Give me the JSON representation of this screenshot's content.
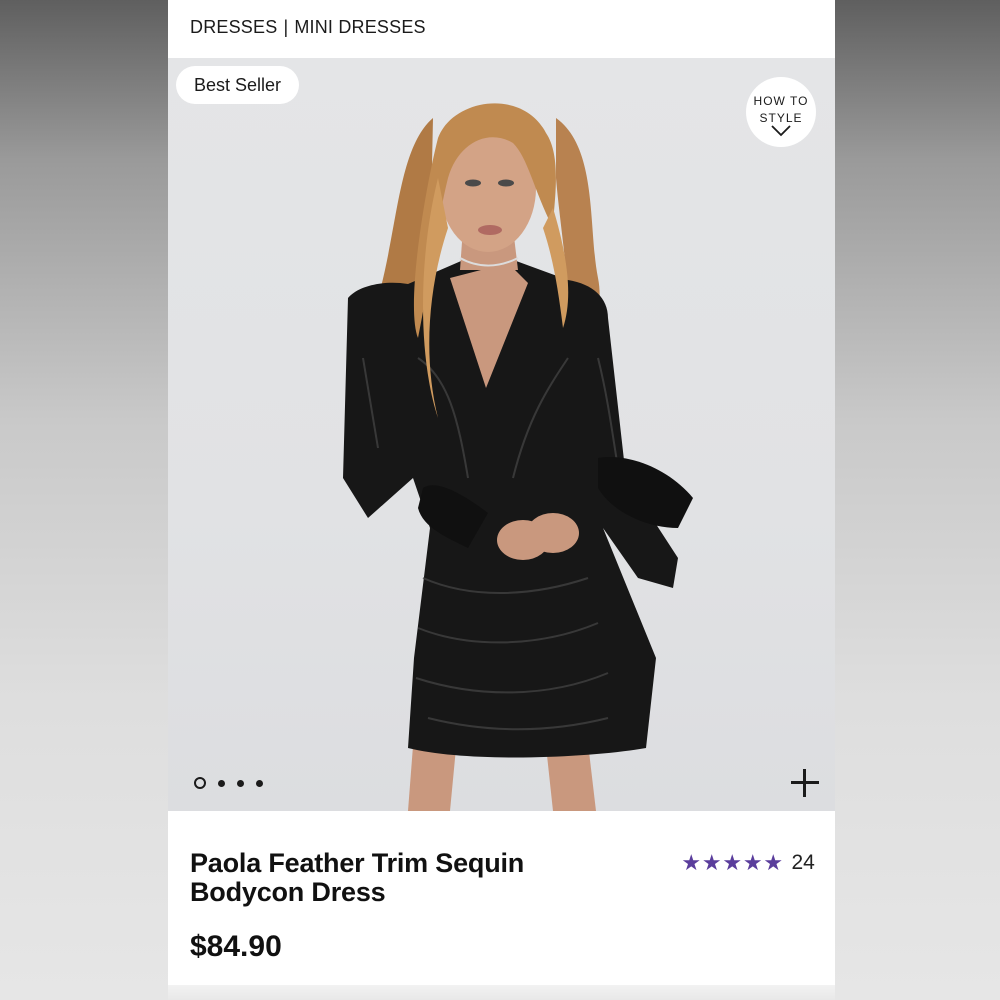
{
  "breadcrumb": {
    "category": "DRESSES",
    "separator": "|",
    "subcategory": "MINI DRESSES"
  },
  "hero": {
    "badge": "Best Seller",
    "how_to_style": {
      "line1": "HOW TO",
      "line2": "STYLE",
      "icon": "chevron-down-icon"
    },
    "carousel": {
      "total_images": 4,
      "active_index": 0
    },
    "zoom_icon": "plus-icon"
  },
  "product": {
    "title": "Paola Feather Trim Sequin Bodycon Dress",
    "price": "$84.90",
    "rating": {
      "stars": 5,
      "count": "24",
      "color": "#5a3d9c"
    }
  }
}
